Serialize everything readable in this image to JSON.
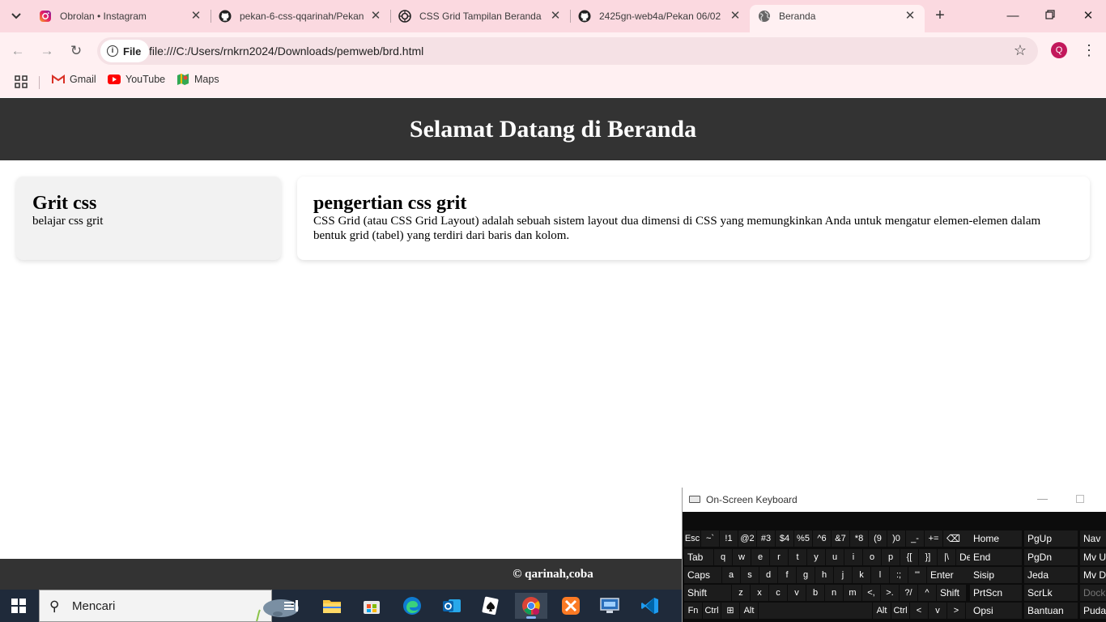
{
  "browser": {
    "tabs": [
      {
        "title": "Obrolan • Instagram",
        "icon": "instagram-icon"
      },
      {
        "title": "pekan-6-css-qqarinah/Pekan",
        "icon": "github-icon"
      },
      {
        "title": "CSS Grid Tampilan Beranda",
        "icon": "openai-icon"
      },
      {
        "title": "2425gn-web4a/Pekan 06/02",
        "icon": "github-icon"
      },
      {
        "title": "Beranda",
        "icon": "globe-icon",
        "active": true
      }
    ],
    "address": {
      "scheme_chip": "File",
      "url": "file:///C:/Users/rnkrn2024/Downloads/pemweb/brd.html"
    },
    "profile_initial": "Q",
    "bookmarks": [
      {
        "label": "Gmail",
        "icon": "gmail-icon"
      },
      {
        "label": "YouTube",
        "icon": "youtube-icon"
      },
      {
        "label": "Maps",
        "icon": "maps-icon"
      }
    ]
  },
  "page": {
    "header_title": "Selamat Datang di Beranda",
    "card_left": {
      "title": "Grit css",
      "text": "belajar css grit"
    },
    "card_right": {
      "title": "pengertian css grit",
      "text": "CSS Grid (atau CSS Grid Layout) adalah sebuah sistem layout dua dimensi di CSS yang memungkinkan Anda untuk mengatur elemen-elemen dalam bentuk grid (tabel) yang terdiri dari baris dan kolom."
    },
    "footer": "© qarinah,coba"
  },
  "osk": {
    "title": "On-Screen Keyboard",
    "row1": [
      "Esc",
      "~`",
      "!1",
      "@2",
      "#3",
      "$4",
      "%5",
      "^6",
      "&7",
      "*8",
      "(9",
      ")0",
      "_-",
      "+=",
      "⌫"
    ],
    "row2": [
      "Tab",
      "q",
      "w",
      "e",
      "r",
      "t",
      "y",
      "u",
      "i",
      "o",
      "p",
      "{[",
      "}]",
      "|\\",
      "Del"
    ],
    "row3": [
      "Caps",
      "a",
      "s",
      "d",
      "f",
      "g",
      "h",
      "j",
      "k",
      "l",
      ":;",
      "\"'",
      "Enter"
    ],
    "row4": [
      "Shift",
      "z",
      "x",
      "c",
      "v",
      "b",
      "n",
      "m",
      "<,",
      ">.",
      "?/",
      "^",
      "Shift"
    ],
    "row5": [
      "Fn",
      "Ctrl",
      "⊞",
      "Alt",
      "",
      "Alt",
      "Ctrl",
      "<",
      "v",
      ">",
      "▤"
    ],
    "nav_col1": [
      "Home",
      "End",
      "Sisip",
      "PrtScn",
      "Opsi"
    ],
    "nav_col2": [
      "PgUp",
      "PgDn",
      "Jeda",
      "ScrLk",
      "Bantuan"
    ],
    "nav_col3": [
      "Nav",
      "Mv Up",
      "Mv Dn",
      "Dock",
      "Puda"
    ]
  },
  "taskbar": {
    "search_placeholder": "Mencari",
    "apps": [
      "task-view-icon",
      "file-explorer-icon",
      "store-icon",
      "edge-icon",
      "outlook-icon",
      "solitaire-icon",
      "chrome-icon",
      "xampp-icon",
      "remote-desktop-icon",
      "vscode-icon"
    ]
  },
  "colors": {
    "tabstrip": "#fbd9e0",
    "toolbar": "#fff0f2",
    "page_header_bg": "#333333",
    "card_left_bg": "#f2f2f2",
    "taskbar": "#1f2a3a"
  }
}
